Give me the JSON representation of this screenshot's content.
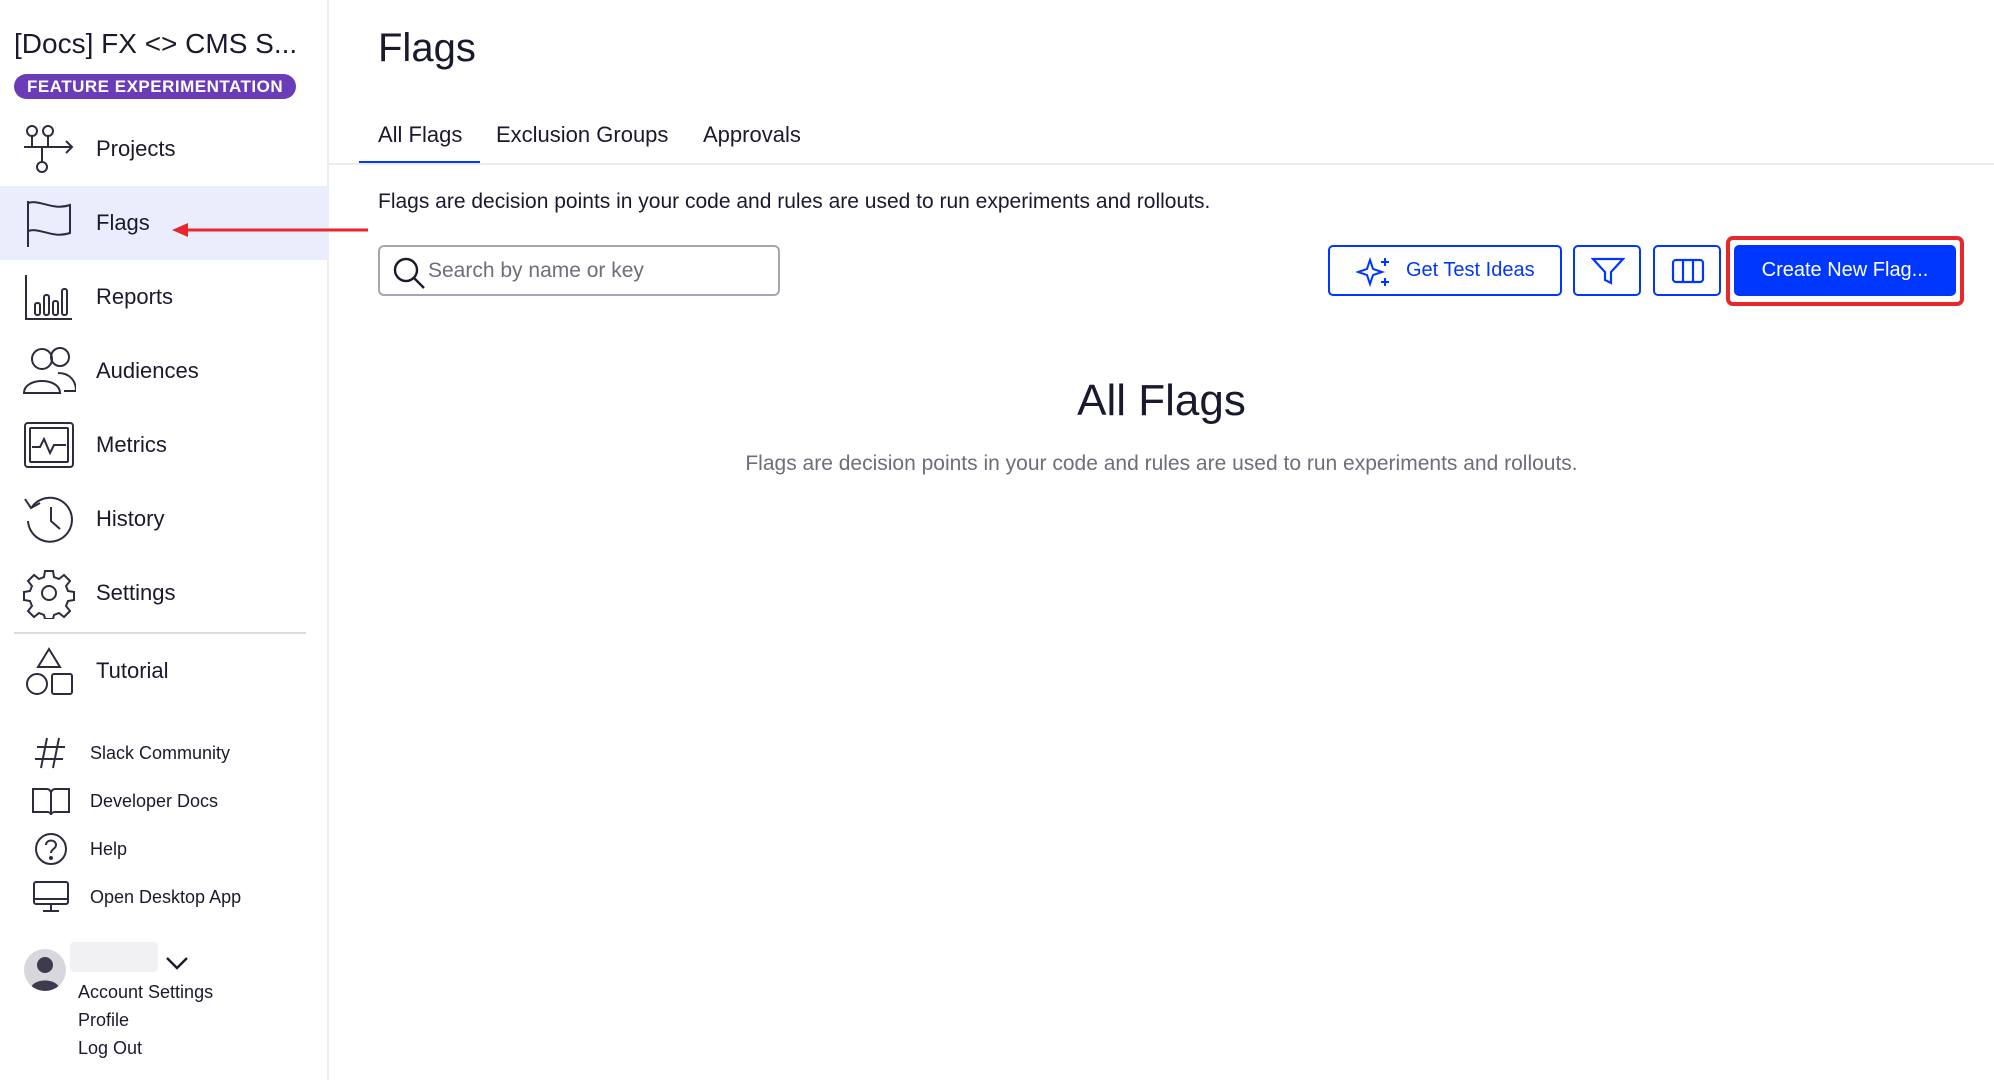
{
  "sidebar": {
    "project_name": "[Docs] FX <> CMS S...",
    "product_badge": "FEATURE EXPERIMENTATION",
    "nav": [
      {
        "label": "Projects",
        "icon": "projects-icon"
      },
      {
        "label": "Flags",
        "icon": "flag-icon",
        "active": true
      },
      {
        "label": "Reports",
        "icon": "reports-chart-icon"
      },
      {
        "label": "Audiences",
        "icon": "audiences-icon"
      },
      {
        "label": "Metrics",
        "icon": "metrics-icon"
      },
      {
        "label": "History",
        "icon": "history-icon"
      },
      {
        "label": "Settings",
        "icon": "gear-icon"
      },
      {
        "label": "Tutorial",
        "icon": "shapes-icon"
      }
    ],
    "links": [
      {
        "label": "Slack Community",
        "icon": "hashtag-icon"
      },
      {
        "label": "Developer Docs",
        "icon": "book-icon"
      },
      {
        "label": "Help",
        "icon": "help-circle-icon"
      },
      {
        "label": "Open Desktop App",
        "icon": "desktop-icon"
      }
    ],
    "account": {
      "settings_label": "Account Settings",
      "profile_label": "Profile",
      "logout_label": "Log Out"
    }
  },
  "main": {
    "page_title": "Flags",
    "tabs": [
      {
        "label": "All Flags",
        "active": true
      },
      {
        "label": "Exclusion Groups"
      },
      {
        "label": "Approvals"
      }
    ],
    "intro": "Flags are decision points in your code and rules are used to run experiments and rollouts.",
    "search": {
      "placeholder": "Search by name or key",
      "value": ""
    },
    "buttons": {
      "test_ideas": "Get Test Ideas",
      "create_flag": "Create New Flag..."
    },
    "empty_state": {
      "title": "All Flags",
      "description": "Flags are decision points in your code and rules are used to run experiments and rollouts."
    }
  },
  "colors": {
    "accent": "#0037ff",
    "badge": "#6b3cb8",
    "active_nav_bg": "#eaeefc",
    "annotation": "#e8262e"
  }
}
